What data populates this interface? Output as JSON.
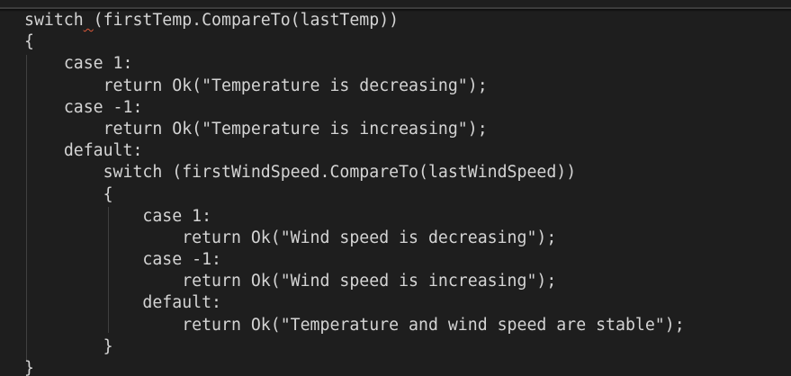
{
  "editor": {
    "background": "#1e1e1e",
    "text_color": "#d4d4d4",
    "error_squiggle_color": "#e05a3a",
    "lines": [
      {
        "indent": 0,
        "text": "switch",
        "squiggle": " ",
        "rest": "(firstTemp.CompareTo(lastTemp))"
      },
      {
        "indent": 0,
        "text": "{"
      },
      {
        "indent": 4,
        "text": "case 1:"
      },
      {
        "indent": 8,
        "text": "return Ok(\"Temperature is decreasing\");"
      },
      {
        "indent": 4,
        "text": "case -1:"
      },
      {
        "indent": 8,
        "text": "return Ok(\"Temperature is increasing\");"
      },
      {
        "indent": 4,
        "text": "default:"
      },
      {
        "indent": 8,
        "text": "switch (firstWindSpeed.CompareTo(lastWindSpeed))"
      },
      {
        "indent": 8,
        "text": "{"
      },
      {
        "indent": 12,
        "text": "case 1:"
      },
      {
        "indent": 16,
        "text": "return Ok(\"Wind speed is decreasing\");"
      },
      {
        "indent": 12,
        "text": "case -1:"
      },
      {
        "indent": 16,
        "text": "return Ok(\"Wind speed is increasing\");"
      },
      {
        "indent": 12,
        "text": "default:"
      },
      {
        "indent": 16,
        "text": "return Ok(\"Temperature and wind speed are stable\");"
      },
      {
        "indent": 8,
        "text": "}"
      },
      {
        "indent": 0,
        "text": "}"
      }
    ]
  }
}
